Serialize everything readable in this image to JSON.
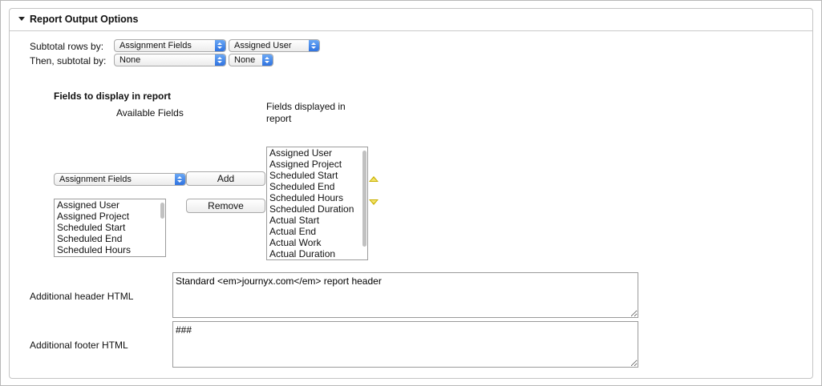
{
  "section": {
    "title": "Report Output Options",
    "toggle_icon": "triangle-down-icon"
  },
  "subtotal": {
    "rows_label": "Subtotal rows by:",
    "rows_category": "Assignment Fields",
    "rows_field": "Assigned User",
    "then_label": "Then, subtotal by:",
    "then_category": "None",
    "then_field": "None"
  },
  "fields": {
    "heading": "Fields to display in report",
    "available_label": "Available Fields",
    "displayed_label_line1": "Fields displayed in",
    "displayed_label_line2": "report",
    "available_category": "Assignment Fields",
    "add_label": "Add",
    "remove_label": "Remove",
    "available_items": [
      "Assigned User",
      "Assigned Project",
      "Scheduled Start",
      "Scheduled End",
      "Scheduled Hours"
    ],
    "displayed_items": [
      "Assigned User",
      "Assigned Project",
      "Scheduled Start",
      "Scheduled End",
      "Scheduled Hours",
      "Scheduled Duration",
      "Actual Start",
      "Actual End",
      "Actual Work",
      "Actual Duration"
    ],
    "move_up_icon": "move-up-arrow-icon",
    "move_down_icon": "move-down-arrow-icon"
  },
  "html": {
    "header_label": "Additional header HTML",
    "header_value": "Standard <em>journyx.com</em> report header",
    "footer_label": "Additional footer HTML",
    "footer_value": "###"
  }
}
